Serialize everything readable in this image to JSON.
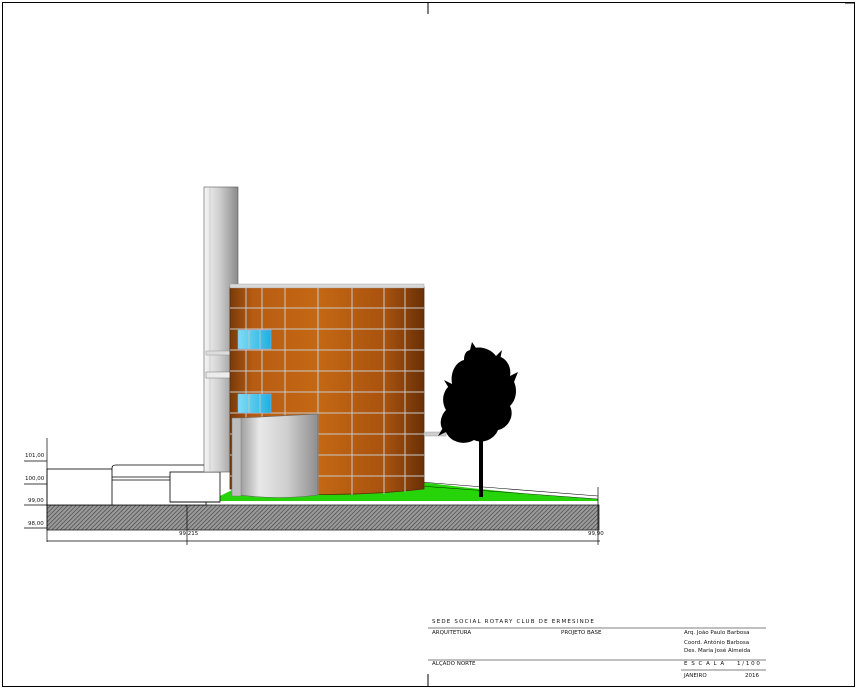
{
  "drawing": {
    "view": "elevation",
    "colors": {
      "facade": "#b35a12",
      "facade_dark": "#7a3a08",
      "mullion": "#c9c9c9",
      "glazing": "#37c3ee",
      "grass": "#27d40a",
      "ground_hatch": "#555555",
      "tree": "#000000"
    },
    "levels": [
      "101,00",
      "100,00",
      "99,00",
      "98,00"
    ],
    "dimensions": [
      "99,215",
      "99,90"
    ]
  },
  "title_block": {
    "project": "SEDE SOCIAL ROTARY CLUB DE ERMESINDE",
    "discipline": "ARQUITETURA",
    "phase": "PROJETO BASE",
    "architect": "Arq. João Paulo Barbosa",
    "coordinator": "Coord. António Barbosa",
    "drawn_by": "Des. Maria José Almeida",
    "sheet_title": "ALÇADO NORTE",
    "scale_label": "E S C A L A",
    "scale_value": "1 / 1 0 0",
    "month": "JANEIRO",
    "year": "2016"
  }
}
